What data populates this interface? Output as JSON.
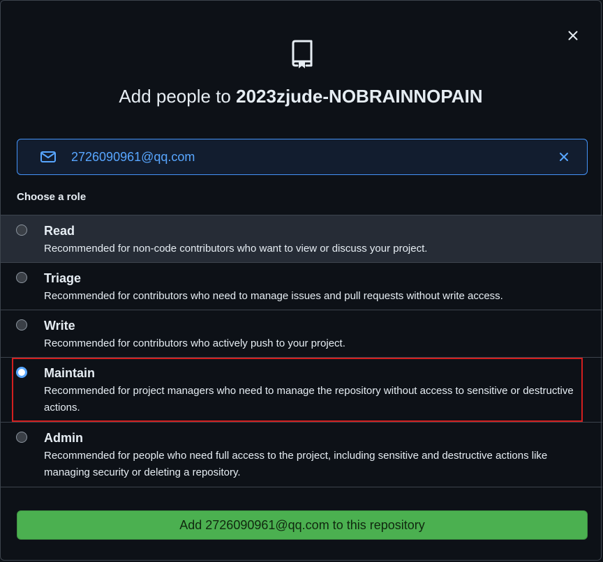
{
  "dialog": {
    "title_prefix": "Add people to ",
    "repo_name": "2023zjude-NOBRAINNOPAIN",
    "close_icon": "close-icon",
    "repo_icon": "repo-icon"
  },
  "email_field": {
    "value": "2726090961@qq.com",
    "leading_icon": "mail-icon",
    "trailing_icon": "clear-icon"
  },
  "roles": {
    "heading": "Choose a role",
    "selected": "Maintain",
    "items": [
      {
        "name": "Read",
        "description": "Recommended for non-code contributors who want to view or discuss your project."
      },
      {
        "name": "Triage",
        "description": "Recommended for contributors who need to manage issues and pull requests without write access."
      },
      {
        "name": "Write",
        "description": "Recommended for contributors who actively push to your project."
      },
      {
        "name": "Maintain",
        "description": "Recommended for project managers who need to manage the repository without access to sensitive or destructive actions."
      },
      {
        "name": "Admin",
        "description": "Recommended for people who need full access to the project, including sensitive and destructive actions like managing security or deleting a repository."
      }
    ]
  },
  "submit": {
    "label": "Add 2726090961@qq.com to this repository"
  },
  "colors": {
    "background": "#0d1117",
    "accent_blue": "#58a6ff",
    "submit_green": "#4bb050",
    "highlight_red": "#d21f1f"
  }
}
